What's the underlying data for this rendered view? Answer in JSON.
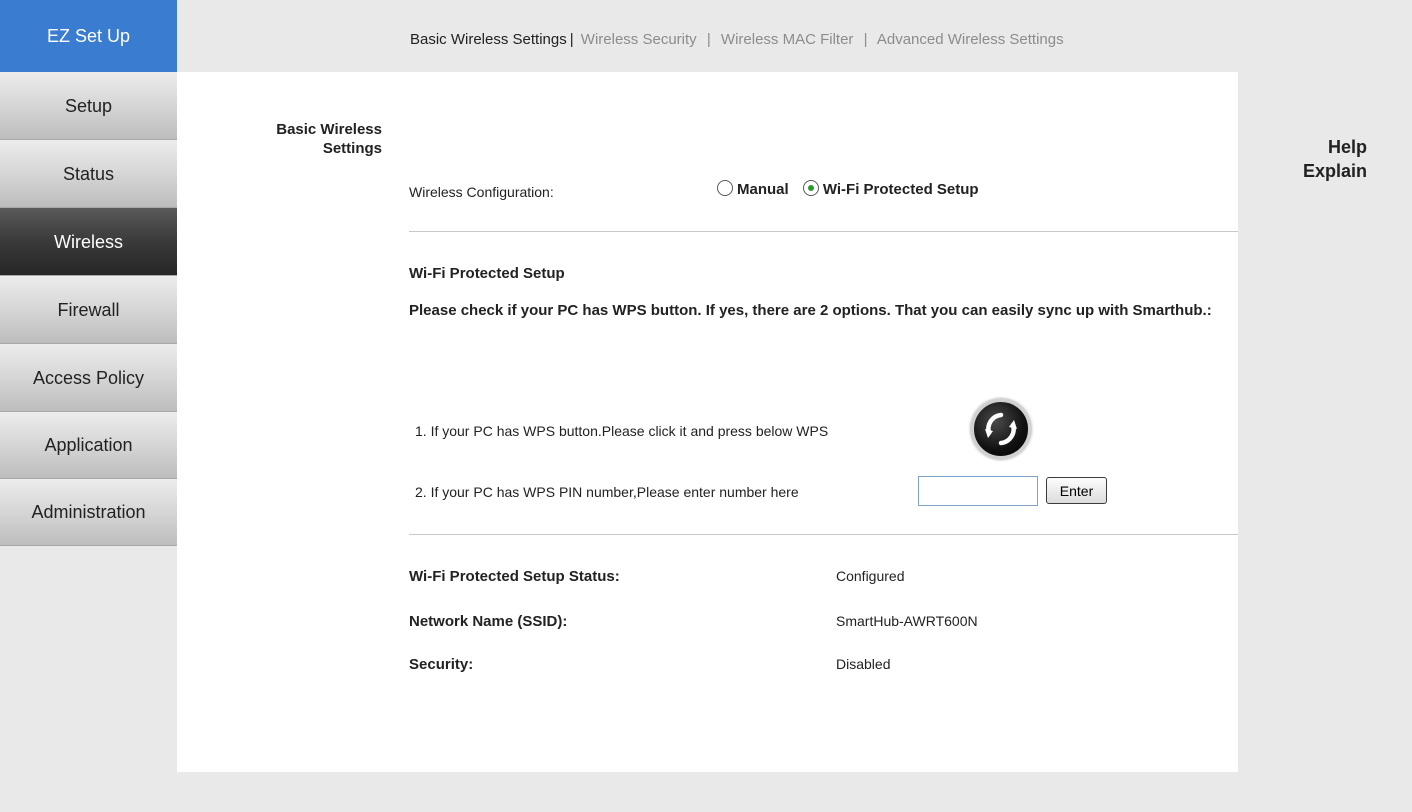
{
  "sidebar": {
    "items": [
      {
        "label": "EZ Set Up"
      },
      {
        "label": "Setup"
      },
      {
        "label": "Status"
      },
      {
        "label": "Wireless"
      },
      {
        "label": "Firewall"
      },
      {
        "label": "Access Policy"
      },
      {
        "label": "Application"
      },
      {
        "label": "Administration"
      }
    ],
    "active": "Wireless"
  },
  "tabs": {
    "items": [
      {
        "label": "Basic Wireless Settings",
        "active": true
      },
      {
        "label": "Wireless Security",
        "active": false
      },
      {
        "label": "Wireless MAC Filter",
        "active": false
      },
      {
        "label": "Advanced Wireless Settings",
        "active": false
      }
    ],
    "separator": "|"
  },
  "section_title": {
    "line1": "Basic Wireless",
    "line2": "Settings"
  },
  "help": {
    "line1": "Help",
    "line2": "Explain"
  },
  "wireless_config": {
    "label": "Wireless Configuration:",
    "options": [
      {
        "label": "Manual",
        "checked": false
      },
      {
        "label": "Wi-Fi Protected Setup",
        "checked": true
      }
    ]
  },
  "wps": {
    "heading": "Wi-Fi Protected Setup",
    "description": "Please check if your PC has WPS button. If yes, there are 2 options. That you can easily sync up with Smarthub.:",
    "option1": "1. If your PC has WPS button.Please click it and press below WPS",
    "option2": "2. If your PC has WPS PIN number,Please enter number here",
    "pin_value": "",
    "enter_label": "Enter"
  },
  "status": {
    "wps_status_label": "Wi-Fi Protected Setup Status:",
    "wps_status_value": "Configured",
    "ssid_label": "Network Name (SSID):",
    "ssid_value": "SmartHub-AWRT600N",
    "security_label": "Security:",
    "security_value": "Disabled"
  },
  "colors": {
    "ez_setup_bg": "#3a7ccf",
    "active_nav_bg": "#333333",
    "radio_check": "#2a9a2a"
  },
  "icons": {
    "wps_button": "wps-refresh-icon"
  }
}
